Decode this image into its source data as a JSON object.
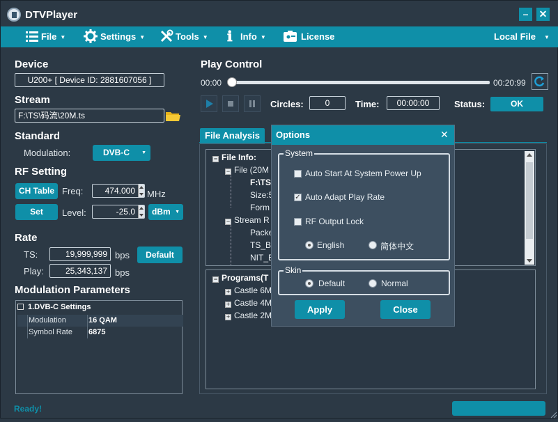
{
  "window": {
    "title": "DTVPlayer",
    "minimize": "–",
    "close": "✕"
  },
  "menu": {
    "file": "File",
    "settings": "Settings",
    "tools": "Tools",
    "info": "Info",
    "license": "License",
    "source": "Local File"
  },
  "device": {
    "heading": "Device",
    "value": "U200+ [ Device ID: 2881607056 ]"
  },
  "stream": {
    "heading": "Stream",
    "path": "F:\\TS\\码流\\20M.ts"
  },
  "standard": {
    "heading": "Standard",
    "modulation_label": "Modulation:",
    "modulation_value": "DVB-C"
  },
  "rf": {
    "heading": "RF Setting",
    "ch_table": "CH Table",
    "freq_label": "Freq:",
    "freq_value": "474.000",
    "freq_unit": "MHz",
    "set": "Set",
    "level_label": "Level:",
    "level_value": "-25.0",
    "level_unit": "dBm"
  },
  "rate": {
    "heading": "Rate",
    "ts_label": "TS:",
    "ts_value": "19,999,999",
    "ts_unit": "bps",
    "default": "Default",
    "play_label": "Play:",
    "play_value": "25,343,137",
    "play_unit": "bps"
  },
  "modparams": {
    "heading": "Modulation Parameters",
    "group": "1.DVB-C Settings",
    "rows": [
      {
        "k": "Modulation",
        "v": "16 QAM"
      },
      {
        "k": "Symbol Rate",
        "v": "6875"
      }
    ]
  },
  "play": {
    "heading": "Play Control",
    "start": "00:00",
    "end": "00:20:99",
    "position": 0.0,
    "circles_label": "Circles:",
    "circles_value": "0",
    "time_label": "Time:",
    "time_value": "00:00:00",
    "status_label": "Status:",
    "status_value": "OK"
  },
  "analysis": {
    "tab": "File Analysis",
    "tree": {
      "file_info": "File Info:",
      "file": "File (20M",
      "path": "F:\\TS",
      "size": "Size:5",
      "form": "Form",
      "stream_r": "Stream R",
      "packet": "Packe",
      "ts_b": "TS_B",
      "nit_b": "NIT_B"
    },
    "programs": {
      "root": "Programs(T",
      "items": [
        "Castle 6M",
        "Castle 4M",
        "Castle 2M"
      ]
    }
  },
  "options": {
    "title": "Options",
    "close": "✕",
    "system": {
      "title": "System",
      "auto_start": "Auto Start At System Power Up",
      "auto_start_checked": false,
      "auto_adapt": "Auto Adapt Play Rate",
      "auto_adapt_checked": true,
      "rf_lock": "RF Output Lock",
      "rf_lock_checked": false,
      "lang_en": "English",
      "lang_cn": "简体中文",
      "lang_selected": "English"
    },
    "skin": {
      "title": "Skin",
      "default": "Default",
      "normal": "Normal",
      "selected": "Default"
    },
    "apply": "Apply",
    "close_btn": "Close"
  },
  "status": {
    "text": "Ready!"
  },
  "colors": {
    "accent": "#0f8fa8",
    "bg": "#2c3945",
    "ready": "#0f8fa8"
  }
}
